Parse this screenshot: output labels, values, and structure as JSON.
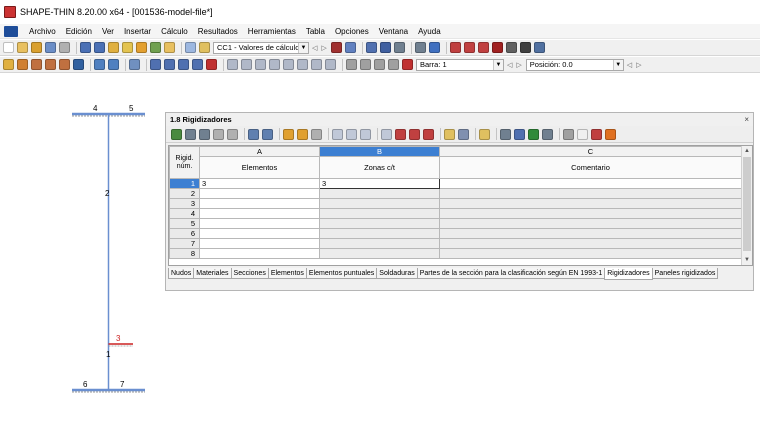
{
  "window": {
    "title": "SHAPE-THIN 8.20.00 x64 - [001536-model-file*]"
  },
  "menu": [
    "Archivo",
    "Edición",
    "Ver",
    "Insertar",
    "Cálculo",
    "Resultados",
    "Herramientas",
    "Tabla",
    "Opciones",
    "Ventana",
    "Ayuda"
  ],
  "toolbar": {
    "load_case": "CC1 - Valores de cálculo",
    "bar_label": "Barra: 1",
    "position_label": "Posición: 0.0"
  },
  "drawing": {
    "nodes": [
      "4",
      "5",
      "2",
      "3",
      "1",
      "6",
      "7"
    ],
    "accent_red": "#cc2222",
    "member_blue": "#6a8fd0"
  },
  "panel": {
    "title": "1.8 Rigidizadores",
    "close": "×",
    "row_header": "Rigid. núm.",
    "columns": [
      {
        "letter": "A",
        "name": "Elementos"
      },
      {
        "letter": "B",
        "name": "Zonas c/t"
      },
      {
        "letter": "C",
        "name": "Comentario"
      }
    ],
    "rows": [
      {
        "num": "1",
        "a": "3",
        "b": "3",
        "c": ""
      },
      {
        "num": "2",
        "a": "",
        "b": "",
        "c": ""
      },
      {
        "num": "3",
        "a": "",
        "b": "",
        "c": ""
      },
      {
        "num": "4",
        "a": "",
        "b": "",
        "c": ""
      },
      {
        "num": "5",
        "a": "",
        "b": "",
        "c": ""
      },
      {
        "num": "6",
        "a": "",
        "b": "",
        "c": ""
      },
      {
        "num": "7",
        "a": "",
        "b": "",
        "c": ""
      },
      {
        "num": "8",
        "a": "",
        "b": "",
        "c": ""
      }
    ],
    "tabs": [
      "Nudos",
      "Materiales",
      "Secciones",
      "Elementos",
      "Elementos puntuales",
      "Soldaduras",
      "Partes de la sección para la clasificación según EN 1993-1",
      "Rigidizadores",
      "Paneles rigidizados"
    ],
    "active_tab": "Rigidizadores",
    "selection_color": "#3c7fd2"
  }
}
